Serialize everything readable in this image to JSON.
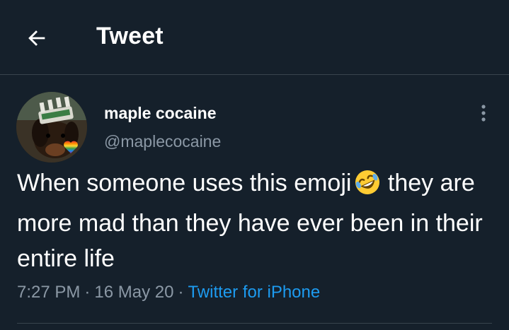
{
  "header": {
    "title": "Tweet",
    "back_icon": "arrow-left-icon"
  },
  "author": {
    "display_name": "maple cocaine",
    "handle": "@maplecocaine",
    "avatar_icon": "avatar-dog-photo",
    "avatar_badge_icon": "rainbow-heart-icon"
  },
  "tweet": {
    "text_before_emoji": "When someone uses this emoji",
    "text_after_emoji": "they are more mad than they have ever been in their entire life",
    "emoji_icon": "rolling-on-floor-laughing-emoji"
  },
  "meta": {
    "time": "7:27 PM",
    "separator": "·",
    "date": "16 May 20",
    "source": "Twitter for iPhone"
  },
  "colors": {
    "background": "#15202b",
    "text_primary": "#ffffff",
    "text_secondary": "#8b98a5",
    "link": "#1d9bf0",
    "border": "#38444d"
  }
}
